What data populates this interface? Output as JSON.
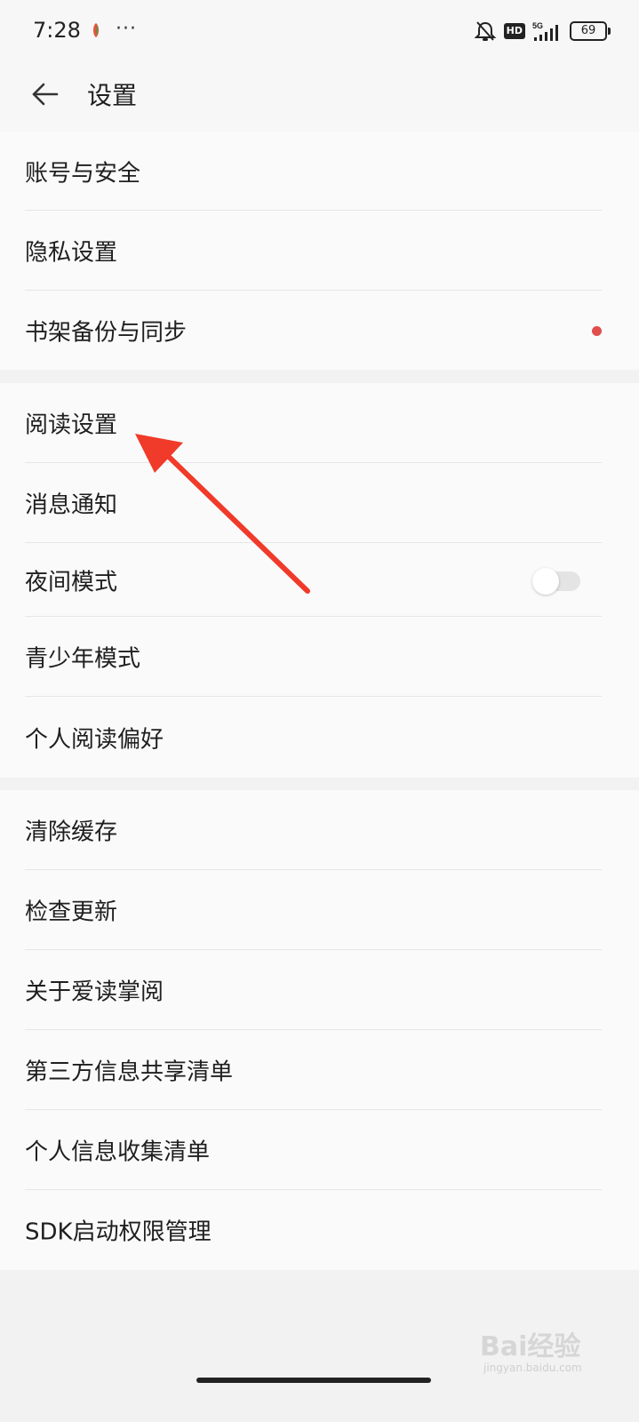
{
  "status_bar": {
    "time": "7:28",
    "dots": "···",
    "hd": "HD",
    "network": "5G",
    "battery": "69",
    "icons": [
      "app-notification-icon",
      "mute-icon",
      "hd-icon",
      "signal-icon",
      "battery-icon"
    ]
  },
  "header": {
    "back_icon": "arrow-left-icon",
    "title": "设置"
  },
  "groups": [
    {
      "items": [
        {
          "label": "账号与安全"
        },
        {
          "label": "隐私设置"
        },
        {
          "label": "书架备份与同步",
          "badge": "red-dot"
        }
      ]
    },
    {
      "items": [
        {
          "label": "阅读设置"
        },
        {
          "label": "消息通知"
        },
        {
          "label": "夜间模式",
          "toggle": false
        },
        {
          "label": "青少年模式"
        },
        {
          "label": "个人阅读偏好"
        }
      ]
    },
    {
      "items": [
        {
          "label": "清除缓存"
        },
        {
          "label": "检查更新"
        },
        {
          "label": "关于爱读掌阅"
        },
        {
          "label": "第三方信息共享清单"
        },
        {
          "label": "个人信息收集清单"
        },
        {
          "label": "SDK启动权限管理"
        }
      ]
    }
  ],
  "annotation": {
    "color": "#f03a2a",
    "points_to": "阅读设置"
  },
  "watermark": {
    "text": "Bai经验",
    "sub": "jingyan.baidu.com"
  },
  "colors": {
    "accent_dot": "#e04e4e",
    "background": "#f2f2f2",
    "card": "#fafafa"
  }
}
